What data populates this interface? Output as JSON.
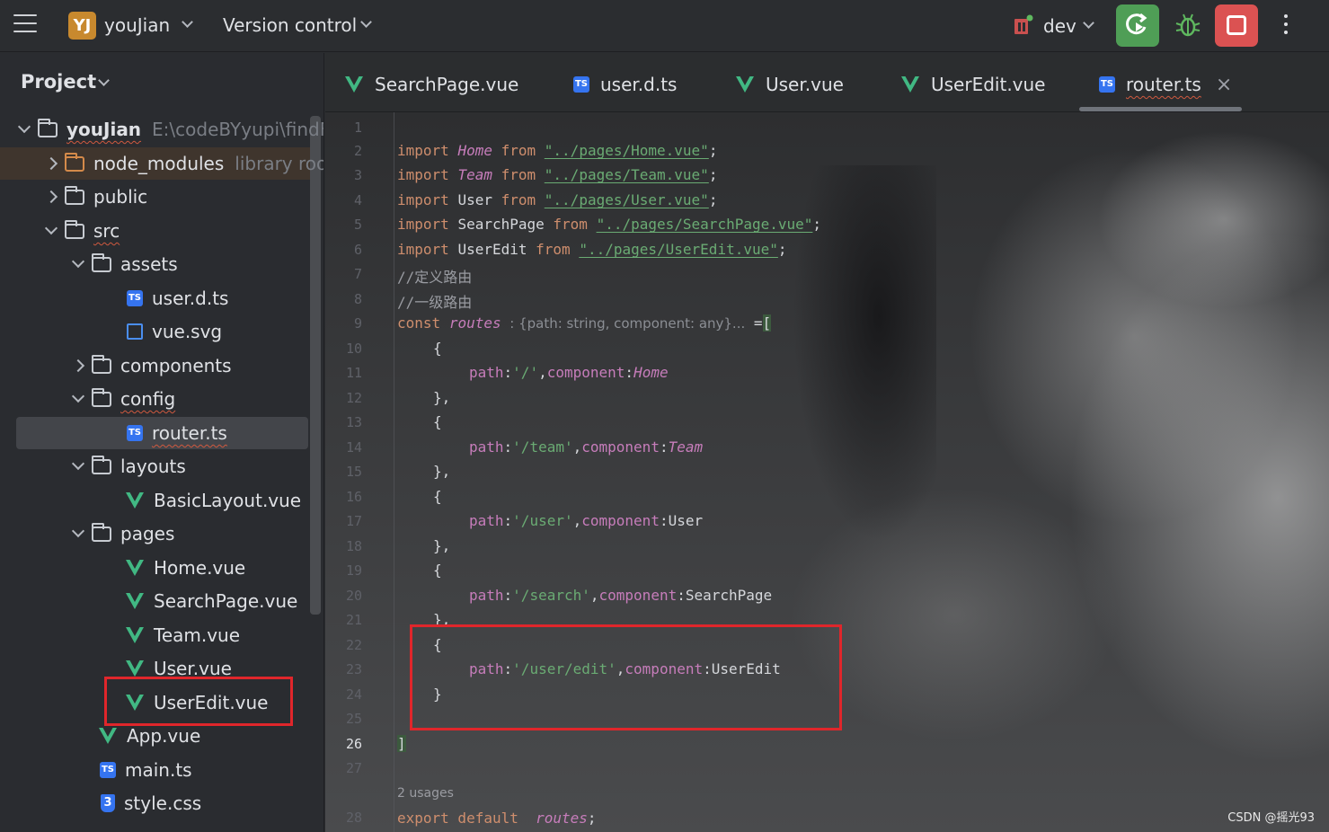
{
  "toolbar": {
    "project_badge": "YJ",
    "project_name": "youJian",
    "version_control": "Version control",
    "branch": "dev"
  },
  "project_panel": {
    "title": "Project",
    "root_name": "youJian",
    "root_path": "E:\\codeBYyupi\\findF",
    "node_modules": "node_modules",
    "library_root": "library root",
    "items": {
      "public": "public",
      "src": "src",
      "assets": "assets",
      "user_d_ts": "user.d.ts",
      "vue_svg": "vue.svg",
      "components": "components",
      "config": "config",
      "router_ts": "router.ts",
      "layouts": "layouts",
      "basic_layout": "BasicLayout.vue",
      "pages": "pages",
      "home": "Home.vue",
      "search_page": "SearchPage.vue",
      "team": "Team.vue",
      "user": "User.vue",
      "user_edit": "UserEdit.vue",
      "app": "App.vue",
      "main_ts": "main.ts",
      "style_css": "style.css"
    }
  },
  "tabs": [
    "SearchPage.vue",
    "user.d.ts",
    "User.vue",
    "UserEdit.vue",
    "router.ts"
  ],
  "editor": {
    "line_numbers": [
      "1",
      "2",
      "3",
      "4",
      "5",
      "6",
      "7",
      "8",
      "9",
      "10",
      "11",
      "12",
      "13",
      "14",
      "15",
      "16",
      "17",
      "18",
      "19",
      "20",
      "21",
      "22",
      "23",
      "24",
      "25",
      "26",
      "27",
      "28"
    ],
    "kw_import": "import",
    "kw_from": "from",
    "kw_const": "const",
    "kw_export": "export default",
    "imports": [
      {
        "name": "Home",
        "path": "\"../pages/Home.vue\""
      },
      {
        "name": "Team",
        "path": "\"../pages/Team.vue\""
      },
      {
        "name": "User",
        "path": "\"../pages/User.vue\""
      },
      {
        "name": "SearchPage",
        "path": "\"../pages/SearchPage.vue\""
      },
      {
        "name": "UserEdit",
        "path": "\"../pages/UserEdit.vue\""
      }
    ],
    "comment1": "//定义路由",
    "comment2": "//一级路由",
    "routes_name": "routes",
    "type_hint": ": {path: string, component: any}...",
    "assign": " =",
    "open_bracket": "[",
    "close_bracket": "]",
    "brace_open": "{",
    "brace_close": "},",
    "brace_close_last": "}",
    "path_key": "path",
    "component_key": "component",
    "routes": [
      {
        "path": "'/'",
        "component": "Home"
      },
      {
        "path": "'/team'",
        "component": "Team"
      },
      {
        "path": "'/user'",
        "component": "User"
      },
      {
        "path": "'/search'",
        "component": "SearchPage"
      },
      {
        "path": "'/user/edit'",
        "component": "UserEdit"
      }
    ],
    "usages": "2 usages",
    "semicolon": ";"
  },
  "watermark": "CSDN @摇光93",
  "colors": {
    "run_button": "#4f9e56",
    "stop_button": "#db5252",
    "highlight_box": "#e0262b",
    "ts_icon": "#3574f0",
    "vue_icon": "#41b883"
  }
}
